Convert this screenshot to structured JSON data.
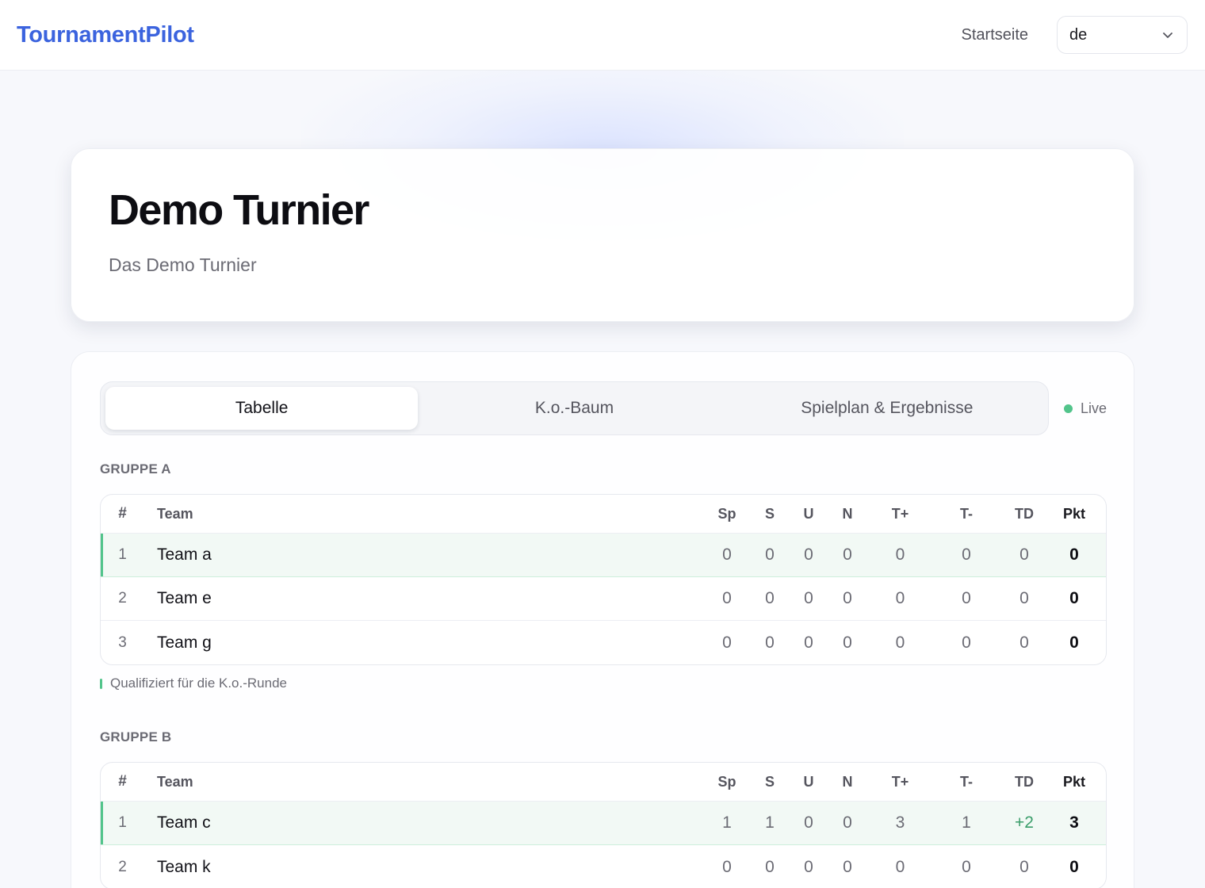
{
  "brand": "TournamentPilot",
  "nav": {
    "home_label": "Startseite",
    "language_value": "de"
  },
  "hero": {
    "title": "Demo Turnier",
    "subtitle": "Das Demo Turnier"
  },
  "tabs": [
    {
      "label": "Tabelle",
      "active": true
    },
    {
      "label": "K.o.-Baum",
      "active": false
    },
    {
      "label": "Spielplan & Ergebnisse",
      "active": false
    }
  ],
  "live_label": "Live",
  "columns": [
    "#",
    "Team",
    "Sp",
    "S",
    "U",
    "N",
    "T+",
    "T-",
    "TD",
    "Pkt"
  ],
  "groups": [
    {
      "title": "GRUPPE A",
      "rows": [
        {
          "rank": "1",
          "team": "Team a",
          "sp": "0",
          "s": "0",
          "u": "0",
          "n": "0",
          "tp": "0",
          "tm": "0",
          "td": "0",
          "pkt": "0",
          "qualified": true
        },
        {
          "rank": "2",
          "team": "Team e",
          "sp": "0",
          "s": "0",
          "u": "0",
          "n": "0",
          "tp": "0",
          "tm": "0",
          "td": "0",
          "pkt": "0",
          "qualified": false
        },
        {
          "rank": "3",
          "team": "Team g",
          "sp": "0",
          "s": "0",
          "u": "0",
          "n": "0",
          "tp": "0",
          "tm": "0",
          "td": "0",
          "pkt": "0",
          "qualified": false
        }
      ],
      "legend": "Qualifiziert für die K.o.-Runde"
    },
    {
      "title": "GRUPPE B",
      "rows": [
        {
          "rank": "1",
          "team": "Team c",
          "sp": "1",
          "s": "1",
          "u": "0",
          "n": "0",
          "tp": "3",
          "tm": "1",
          "td": "+2",
          "pkt": "3",
          "qualified": true
        },
        {
          "rank": "2",
          "team": "Team k",
          "sp": "0",
          "s": "0",
          "u": "0",
          "n": "0",
          "tp": "0",
          "tm": "0",
          "td": "0",
          "pkt": "0",
          "qualified": false
        }
      ]
    }
  ],
  "colors": {
    "brand": "#3b63de",
    "qualified": "#52c48b",
    "positive": "#3a9d6a"
  }
}
